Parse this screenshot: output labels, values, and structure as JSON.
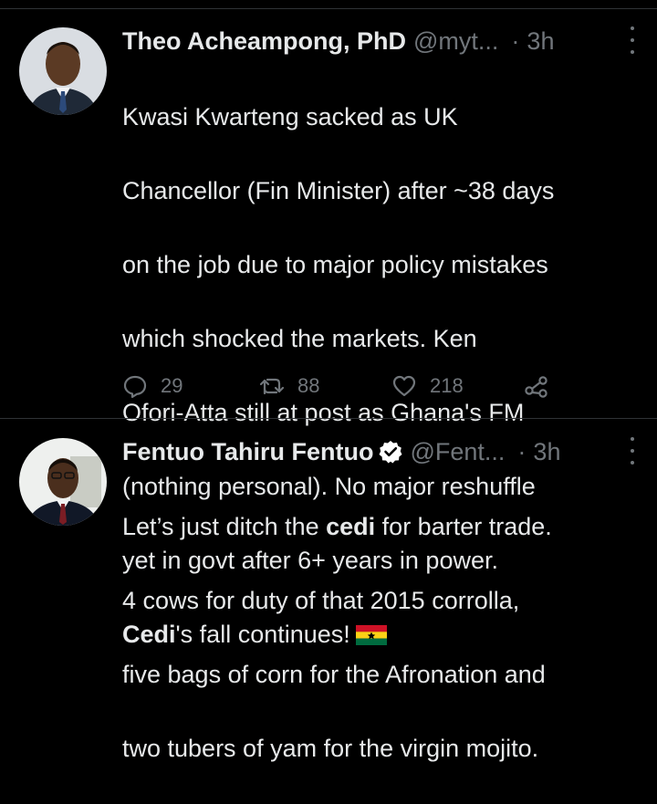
{
  "tweets": [
    {
      "author_name": "Theo Acheampong, PhD",
      "handle": "@myt...",
      "dot": "·",
      "time": "3h",
      "text_lines": [
        "Kwasi Kwarteng sacked as UK",
        "Chancellor (Fin Minister) after ~38 days",
        "on the job due to major policy mistakes",
        "which shocked the markets. Ken",
        "Ofori-Atta still at post as Ghana's FM",
        "(nothing personal). No major reshuffle",
        "yet in govt after 6+ years in power."
      ],
      "last_line_bold": "Cedi",
      "last_line_rest": "'s fall continues!",
      "reply_count": "29",
      "retweet_count": "88",
      "like_count": "218"
    },
    {
      "author_name": "Fentuo Tahiru Fentuo",
      "handle": "@Fent...",
      "dot": "·",
      "time": "3h",
      "first_line_pre": "Let’s just ditch the ",
      "first_line_bold": "cedi",
      "first_line_post": " for barter trade.",
      "text_lines": [
        "4 cows for duty of that 2015 corrolla,",
        "five bags of corn for the Afronation and",
        "two tubers of yam for the virgin mojito."
      ]
    }
  ],
  "colors": {
    "background": "#000000",
    "text": "#e7e9ea",
    "muted": "#71767b",
    "divider": "#2f3336",
    "verified": "#ffffff"
  }
}
